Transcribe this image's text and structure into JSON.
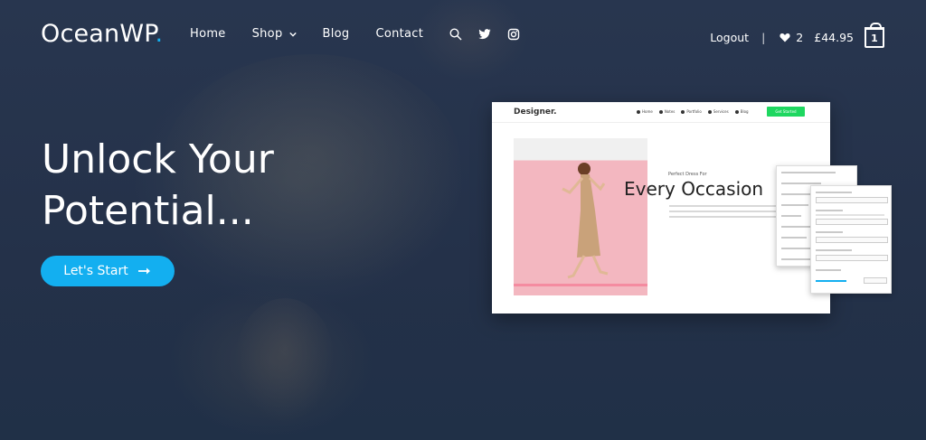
{
  "brand": {
    "name": "OceanWP",
    "dot": ".",
    "accent_color": "#13aff0"
  },
  "nav": {
    "items": [
      {
        "label": "Home"
      },
      {
        "label": "Shop",
        "has_dropdown": true
      },
      {
        "label": "Blog"
      },
      {
        "label": "Contact"
      }
    ],
    "icons": [
      "search-icon",
      "twitter-icon",
      "instagram-icon"
    ]
  },
  "header_right": {
    "logout_label": "Logout",
    "separator": "|",
    "wishlist_count": "2",
    "cart_total": "£44.95",
    "cart_count": "1"
  },
  "hero": {
    "headline": "Unlock Your Potential...",
    "cta_label": "Let's Start",
    "cta_icon": "arrow-right-icon",
    "background_color": "#26344d"
  },
  "mockup": {
    "logo": "Designer.",
    "nav_items": [
      "Home",
      "Notes",
      "Portfolio",
      "Services",
      "Blog"
    ],
    "cta_label": "Get Started",
    "cta_color": "#1ed760",
    "kicker": "Perfect Dress For",
    "heading": "Every Occasion",
    "panel_back_items": [
      "General Options",
      "Typography",
      "Top Bar",
      "Header",
      "Blog",
      "WooCommerce",
      "Sidebar",
      "Footer Widgets",
      "Footer Bottom"
    ],
    "panel_front_labels": [
      "Font Family",
      "Font Weight",
      "Font Style",
      "Text Transform",
      "Line Height"
    ],
    "panel_front_values": [
      "Default",
      "Default",
      "Default",
      "Default"
    ]
  }
}
